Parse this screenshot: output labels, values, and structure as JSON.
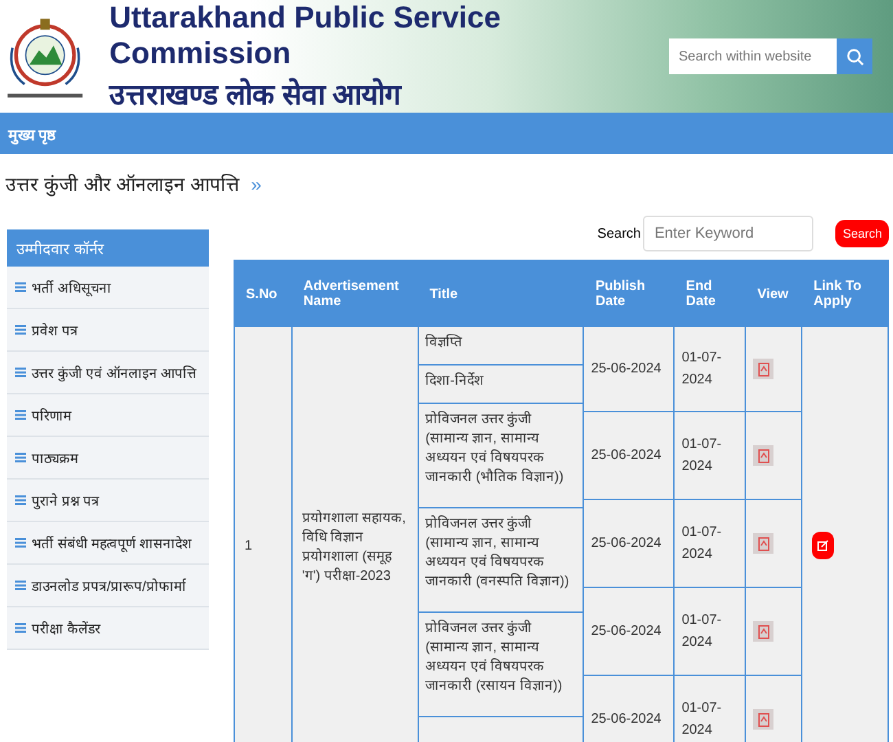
{
  "header": {
    "title": "Uttarakhand Public Service Commission",
    "subtitle": "उत्तराखण्ड लोक सेवा आयोग",
    "search": {
      "placeholder": "Search within website"
    }
  },
  "nav": {
    "items": [
      "मुख्य पृष्ठ"
    ]
  },
  "page_heading": {
    "text": "उत्तर कुंजी और ऑनलाइन आपत्ति",
    "chevron": "»"
  },
  "sidebar": {
    "title": "उम्मीदवार कॉर्नर",
    "items": [
      "भर्ती अधिसूचना",
      "प्रवेश पत्र",
      "उत्तर कुंजी एवं ऑनलाइन आपत्ति",
      "परिणाम",
      "पाठ्यक्रम",
      "पुराने प्रश्न पत्र",
      "भर्ती संबंधी महत्वपूर्ण शासनादेश",
      "डाउनलोड प्रपत्र/प्रारूप/प्रोफार्मा",
      "परीक्षा कैलेंडर"
    ]
  },
  "table_search": {
    "label": "Search",
    "placeholder": "Enter Keyword",
    "button": "Search"
  },
  "table": {
    "columns": [
      "S.No",
      "Advertisement Name",
      "Title",
      "Publish Date",
      "End Date",
      "View",
      "Link To Apply"
    ],
    "rows": [
      {
        "sno": "1",
        "advertisement_name": "प्रयोगशाला सहायक, विधि विज्ञान प्रयोगशाला (समूह 'ग') परीक्षा-2023",
        "titles": [
          "विज्ञप्ति",
          "दिशा-निर्देश",
          "प्रोविजनल उत्तर कुंजी (सामान्य ज्ञान, सामान्य अध्ययन एवं विषयपरक जानकारी (भौतिक विज्ञान))",
          "प्रोविजनल उत्तर कुंजी (सामान्य ज्ञान, सामान्य अध्ययन एवं विषयपरक जानकारी (वनस्पति विज्ञान))",
          "प्रोविजनल उत्तर कुंजी (सामान्य ज्ञान, सामान्य अध्ययन एवं विषयपरक जानकारी (रसायन विज्ञान))"
        ],
        "dates": [
          {
            "publish": "25-06-2024",
            "end": "01-07-2024"
          },
          {
            "publish": "25-06-2024",
            "end": "01-07-2024"
          },
          {
            "publish": "25-06-2024",
            "end": "01-07-2024"
          },
          {
            "publish": "25-06-2024",
            "end": "01-07-2024"
          },
          {
            "publish": "25-06-2024",
            "end": "01-07-2024"
          }
        ]
      }
    ]
  }
}
